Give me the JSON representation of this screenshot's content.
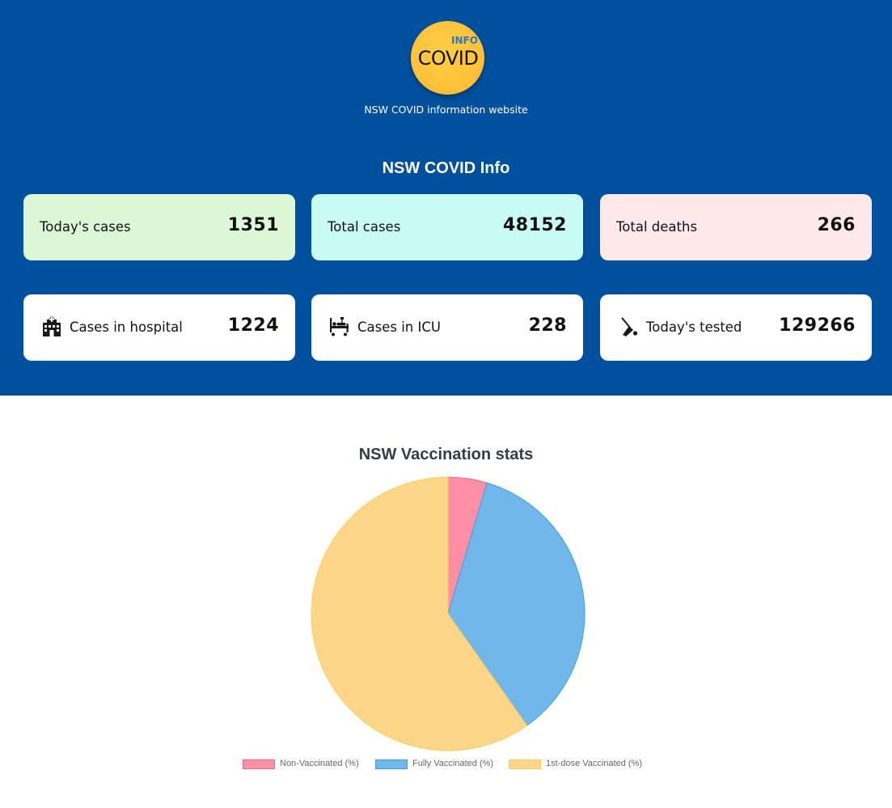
{
  "header": {
    "logo_small": "INFO",
    "logo_main": "COVID",
    "tagline": "NSW COVID information website"
  },
  "info": {
    "title": "NSW COVID Info",
    "cards": [
      {
        "label": "Today's cases",
        "value": "1351",
        "icon": "",
        "bg": "#ddf8d7"
      },
      {
        "label": "Total cases",
        "value": "48152",
        "icon": "",
        "bg": "#c8fcf4"
      },
      {
        "label": "Total deaths",
        "value": "266",
        "icon": "",
        "bg": "#ffe9ea"
      },
      {
        "label": "Cases in hospital",
        "value": "1224",
        "icon": "hospital-icon",
        "bg": "#ffffff"
      },
      {
        "label": "Cases in ICU",
        "value": "228",
        "icon": "hospital-bed-icon",
        "bg": "#ffffff"
      },
      {
        "label": "Today's tested",
        "value": "129266",
        "icon": "test-swab-icon",
        "bg": "#ffffff"
      }
    ]
  },
  "vaccination": {
    "title": "NSW Vaccination stats"
  },
  "colors": {
    "hero_bg": "#00509e",
    "logo": "#ffc13a"
  },
  "chart_data": {
    "type": "pie",
    "title": "NSW Vaccination stats",
    "categories": [
      "Non-Vaccinated (%)",
      "Fully Vaccinated (%)",
      "1st-dose Vaccinated (%)"
    ],
    "values": [
      4.6,
      35.6,
      59.8
    ],
    "colors": [
      "#ff8fa5",
      "#71b7ea",
      "#fdd68a"
    ],
    "border_colors": [
      "#ff6384",
      "#36a2eb",
      "#ffce56"
    ],
    "legend_position": "bottom"
  }
}
